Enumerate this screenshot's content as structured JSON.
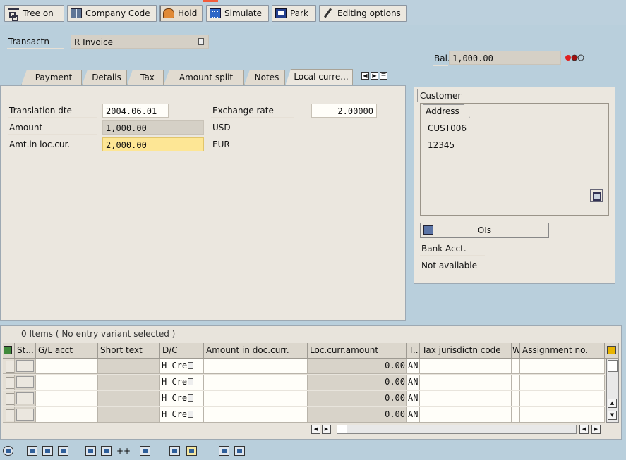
{
  "toolbar": {
    "tree_on": "Tree on",
    "company_code": "Company Code",
    "hold": "Hold",
    "simulate": "Simulate",
    "park": "Park",
    "editing_options": "Editing options"
  },
  "header": {
    "transaction_label": "Transactn",
    "transaction_value": "R Invoice",
    "balance_label": "Bal.",
    "balance_value": "1,000.00"
  },
  "tabs": [
    {
      "label": "Payment"
    },
    {
      "label": "Details"
    },
    {
      "label": "Tax"
    },
    {
      "label": "Amount split"
    },
    {
      "label": "Notes"
    },
    {
      "label": "Local curre..."
    }
  ],
  "local_currency": {
    "translation_date_label": "Translation dte",
    "translation_date_value": "2004.06.01",
    "exchange_rate_label": "Exchange rate",
    "exchange_rate_value": "2.00000",
    "amount_label": "Amount",
    "amount_value": "1,000.00",
    "amount_currency": "USD",
    "local_amount_label": "Amt.in loc.cur.",
    "local_amount_value": "2,000.00",
    "local_currency": "EUR"
  },
  "customer": {
    "tab_label": "Customer",
    "address_tab_label": "Address",
    "address_lines": [
      "CUST006",
      "12345"
    ],
    "ois_button": "OIs",
    "bank_label": "Bank Acct.",
    "bank_value": "Not available"
  },
  "items": {
    "status": "0 Items ( No entry variant selected )",
    "columns": [
      "St...",
      "G/L acct",
      "Short text",
      "D/C",
      "Amount in doc.curr.",
      "Loc.curr.amount",
      "T...",
      "Tax jurisdictn code",
      "W",
      "Assignment no."
    ],
    "rows": [
      {
        "dc": "H Cre",
        "loc_amount": "0.00",
        "tax": "AN"
      },
      {
        "dc": "H Cre",
        "loc_amount": "0.00",
        "tax": "AN"
      },
      {
        "dc": "H Cre",
        "loc_amount": "0.00",
        "tax": "AN"
      },
      {
        "dc": "H Cre",
        "loc_amount": "0.00",
        "tax": "AN"
      }
    ]
  },
  "colors": {
    "toolbar_bg": "#bcd0dd",
    "panel_bg": "#ebe7df",
    "highlight_field": "#fde695",
    "traffic_red": "#e02020"
  }
}
